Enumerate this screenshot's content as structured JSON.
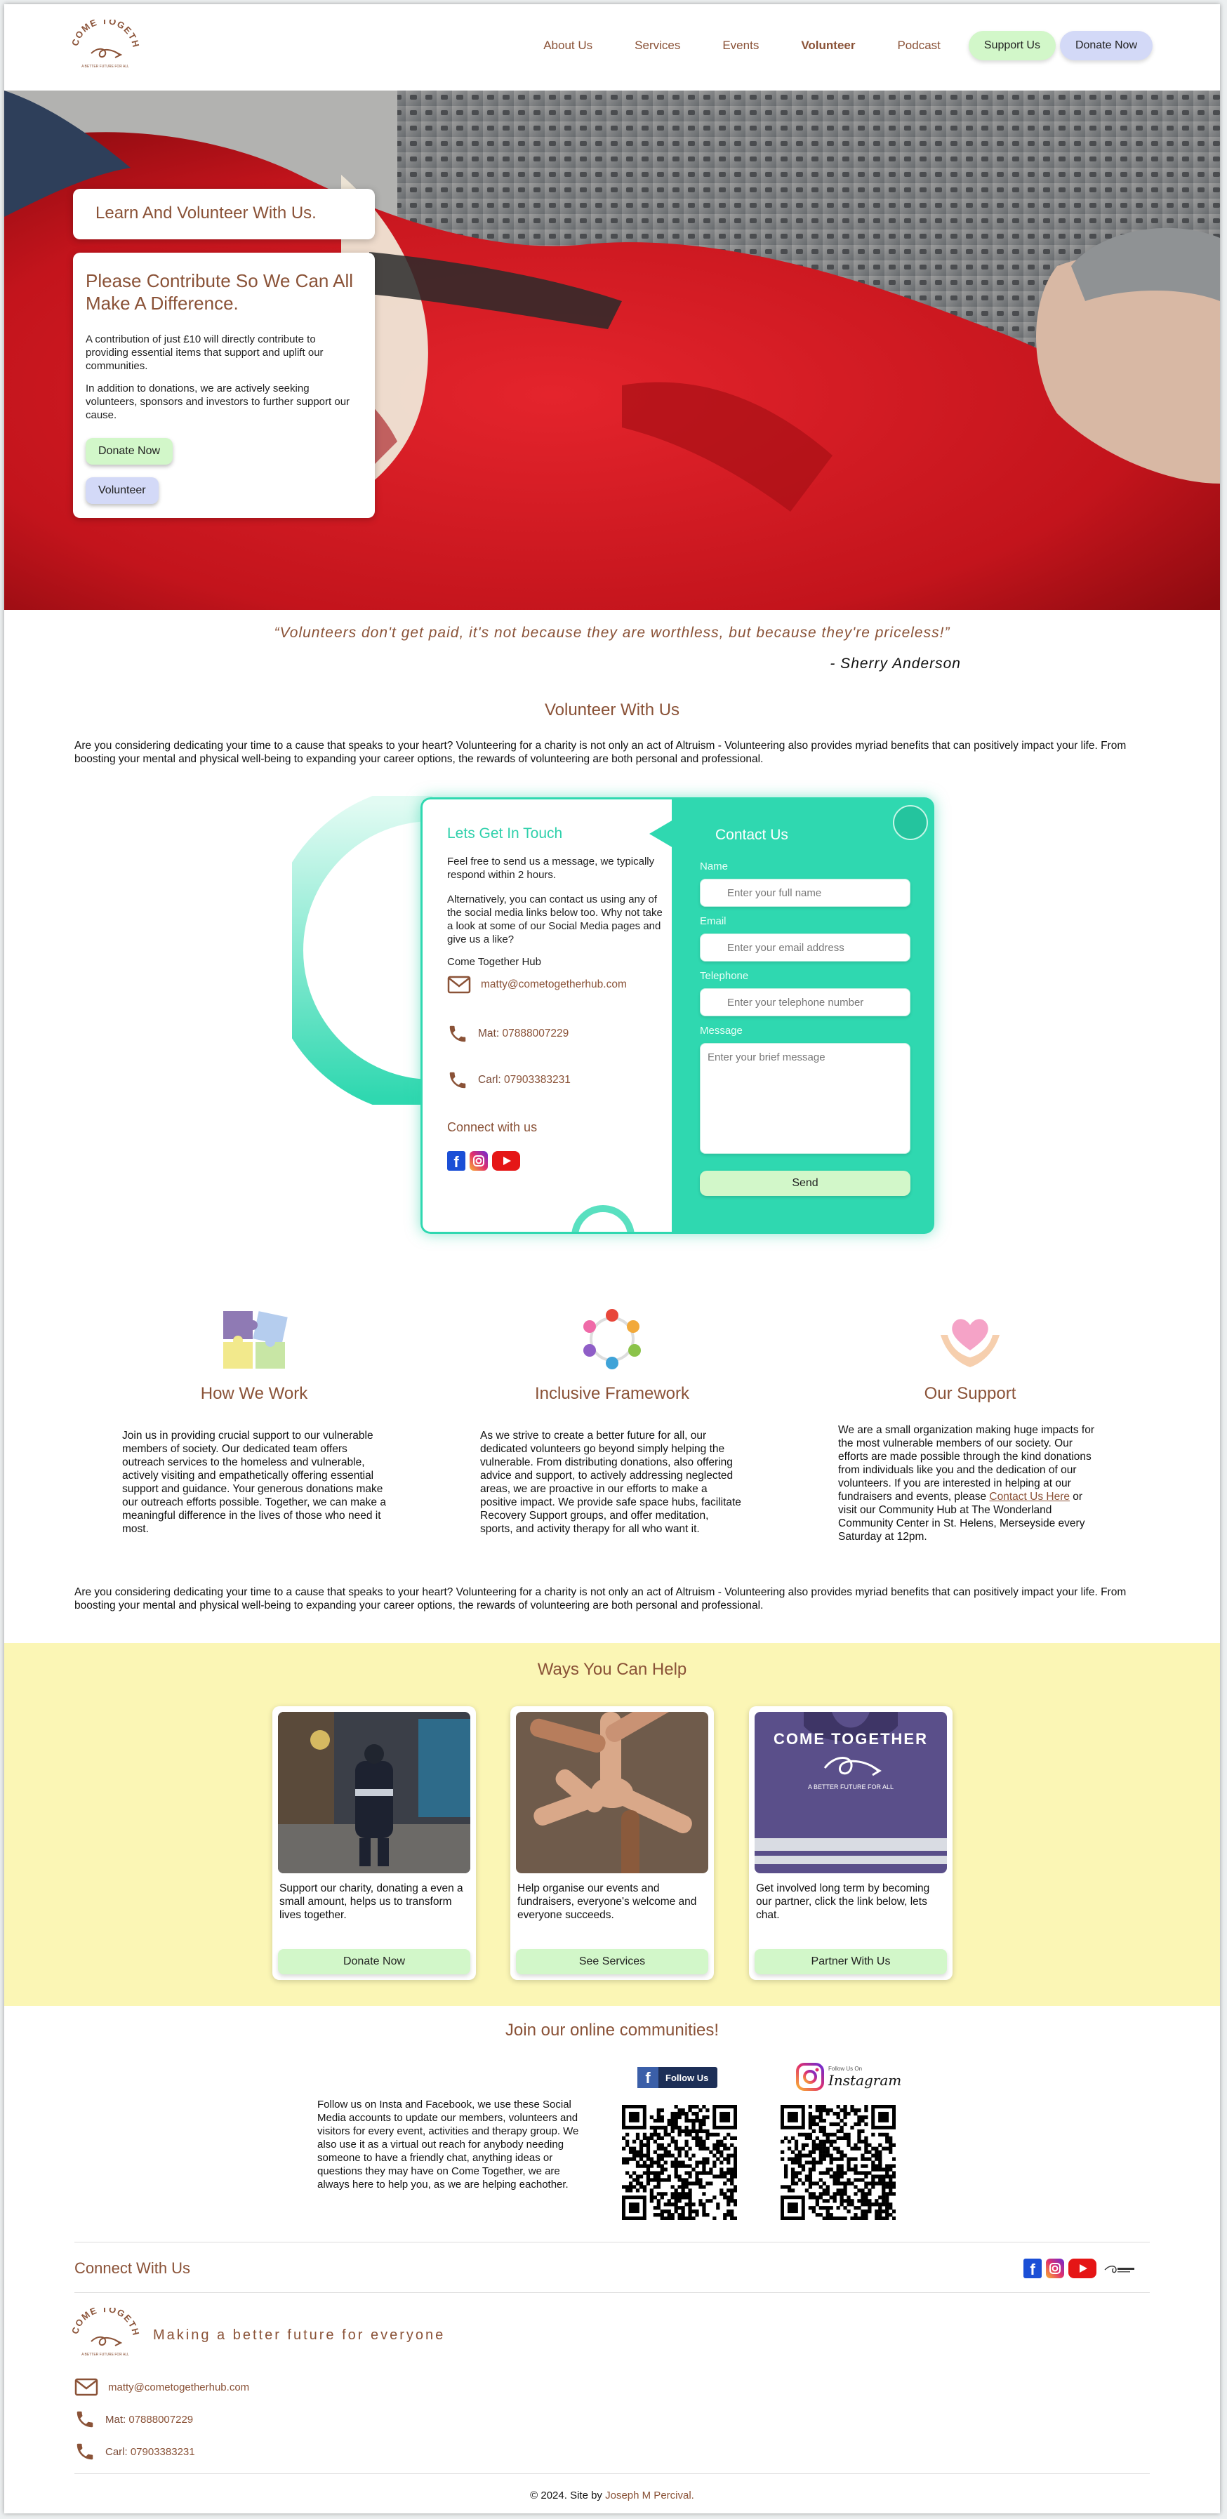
{
  "brand": {
    "logo_text": "COME TOGETHER",
    "logo_sub": "A BETTER FUTURE FOR ALL",
    "accent_brown": "#8a5237",
    "accent_teal": "#2fd8b0",
    "accent_yellow": "#fbf6b5"
  },
  "nav": {
    "links": [
      "About Us",
      "Services",
      "Events",
      "Volunteer",
      "Podcast"
    ],
    "active": "Volunteer",
    "support_label": "Support Us",
    "donate_label": "Donate Now"
  },
  "hero": {
    "title": "Learn And Volunteer With Us.",
    "heading": "Please Contribute So We Can All Make A Difference.",
    "text1": "A contribution of just £10 will directly contribute to providing essential items that support and uplift our communities.",
    "text2": "In addition to donations, we are actively seeking volunteers, sponsors and investors to further support our cause.",
    "donate_label": "Donate Now",
    "volunteer_label": "Volunteer"
  },
  "quote": {
    "text": "“Volunteers don't get paid, it's not because they are worthless, but because they're priceless!”",
    "author": "- Sherry Anderson"
  },
  "volunteer": {
    "title": "Volunteer With Us",
    "text": "Are you considering dedicating your time to a cause that speaks to your heart? Volunteering for a charity is not only an act of Altruism - Volunteering also provides myriad benefits that can positively impact your life. From boosting your mental and physical well-being to expanding your career options, the rewards of volunteering are both personal and professional."
  },
  "contact": {
    "left_title": "Lets Get In Touch",
    "intro1": "Feel free to send us a message, we typically respond within 2 hours.",
    "intro2": "Alternatively, you can contact us using any of the social media links below too. Why not take a look at some of our Social Media pages and give us a like?",
    "org": "Come Together Hub",
    "email": "matty@cometogetherhub.com",
    "phone1_label": "Mat:",
    "phone1": "07888007229",
    "phone2_label": "Carl:",
    "phone2": "07903383231",
    "connect_title": "Connect with us",
    "form_title": "Contact Us",
    "name_label": "Name",
    "name_placeholder": "Enter your full name",
    "email_label": "Email",
    "email_placeholder": "Enter your email address",
    "phone_label": "Telephone",
    "phone_placeholder": "Enter your telephone number",
    "message_label": "Message",
    "message_placeholder": "Enter your brief message",
    "send_label": "Send"
  },
  "features": [
    {
      "title": "How We Work",
      "icon": "puzzle-icon",
      "text": "Join us in providing crucial support to our vulnerable members of society. Our dedicated team offers outreach services to the homeless and vulnerable, actively visiting and empathetically offering essential support and guidance. Your generous donations make our outreach efforts possible. Together, we can make a meaningful difference in the lives of those who need it most."
    },
    {
      "title": "Inclusive Framework",
      "icon": "community-circle-icon",
      "text": "As we strive to create a better future for all, our dedicated volunteers go beyond simply helping the vulnerable. From distributing donations, also offering advice and support, to actively addressing neglected areas, we are proactive in our efforts to make a positive impact. We provide safe space hubs, facilitate Recovery Support groups, and offer meditation, sports, and activity therapy for all who want it."
    },
    {
      "title": "Our Support",
      "icon": "heart-hands-icon",
      "text_before": "We are a small organization making huge impacts for the most vulnerable members of our society. Our efforts are made possible through the kind donations from individuals like you and the dedication of our volunteers. If you are interested in helping at our fundraisers and events, please ",
      "link": "Contact Us Here",
      "text_after": " or visit our Community Hub at The Wonderland Community Center in St. Helens, Merseyside every Saturday at 12pm."
    }
  ],
  "volunteer_repeat": "Are you considering dedicating your time to a cause that speaks to your heart? Volunteering for a charity is not only an act of Altruism - Volunteering also provides myriad benefits that can positively impact your life. From boosting your mental and physical well-being to expanding your career options, the rewards of volunteering are both personal and professional.",
  "ways": {
    "title": "Ways You Can Help",
    "cards": [
      {
        "text": "Support our charity, donating a even a small amount, helps us to transform lives together.",
        "button": "Donate Now"
      },
      {
        "text": "Help organise our events and fundraisers, everyone's welcome and everyone succeeds.",
        "button": "See Services"
      },
      {
        "text": "Get involved long term by becoming our partner, click the link below, lets chat.",
        "button": "Partner With Us"
      }
    ],
    "vest_text": "COME TOGETHER",
    "vest_sub": "A BETTER FUTURE FOR ALL"
  },
  "communities": {
    "title": "Join our online communities!",
    "text": "Follow us on Insta and Facebook, we use these Social Media accounts to update our members, volunteers and visitors for every event, activities and therapy group. We also use it as a virtual out reach for anybody needing someone to have a friendly chat, anything ideas or questions they may have on Come Together, we are always here to help you, as we are helping eachother.",
    "fb_label": "Follow Us",
    "ig_small": "Follow Us On",
    "ig_label": "Instagram"
  },
  "footer": {
    "connect_title": "Connect With Us",
    "tagline": "Making a better future for everyone",
    "email": "matty@cometogetherhub.com",
    "phone1_label": "Mat:",
    "phone1": "07888007229",
    "phone2_label": "Carl:",
    "phone2": "07903383231",
    "copyright": "© 2024. Site by ",
    "author": "Joseph M Percival."
  }
}
